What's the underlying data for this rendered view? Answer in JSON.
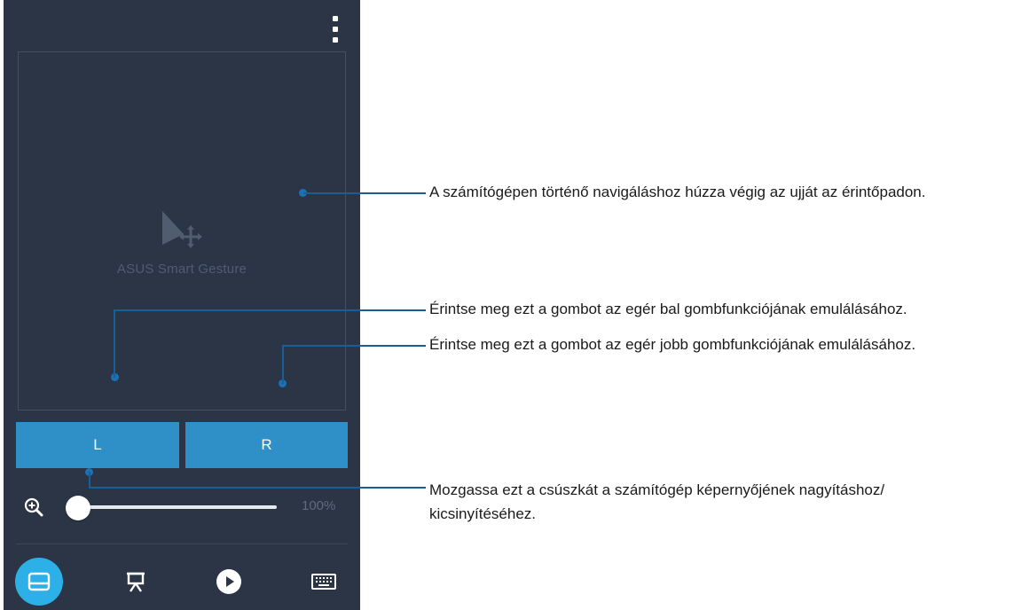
{
  "app": {
    "logo_text": "ASUS Smart Gesture",
    "left_button_label": "L",
    "right_button_label": "R",
    "zoom_value": "100%",
    "zoom_level": 0.0,
    "nav": [
      {
        "icon": "touchpad-icon",
        "active": true
      },
      {
        "icon": "presentation-icon",
        "active": false
      },
      {
        "icon": "play-icon",
        "active": false
      },
      {
        "icon": "keyboard-icon",
        "active": false
      }
    ]
  },
  "annotations": {
    "touchpad": "A számítógépen történő navigáláshoz húzza végig az ujját az érintőpadon.",
    "left_button": "Érintse meg ezt a gombot az egér bal gombfunkciójának emulálásához.",
    "right_button": "Érintse meg ezt a gombot az egér jobb gombfunkciójának emulálásához.",
    "slider_line1": "Mozgassa ezt a csúszkát a számítógép képernyőjének nagyításhoz/",
    "slider_line2": "kicsinyítéséhez."
  },
  "colors": {
    "background": "#2b3545",
    "button": "#2f8fc7",
    "active_nav": "#2db0e8",
    "callout": "#1a5e96"
  }
}
